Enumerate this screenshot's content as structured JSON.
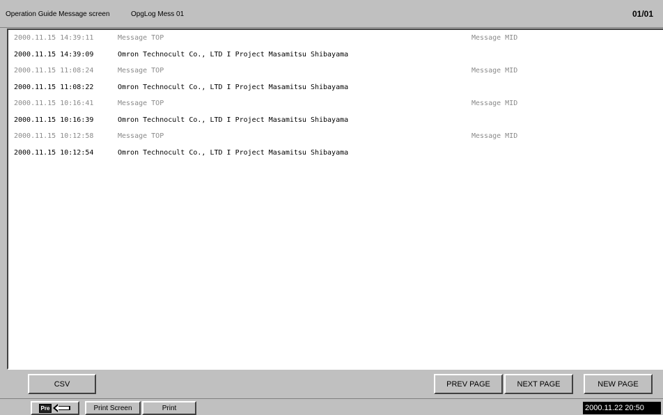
{
  "header": {
    "screen_title": "Operation Guide Message screen",
    "screen_id": "OpgLog Mess 01",
    "page_indicator": "01/01"
  },
  "log_rows": [
    {
      "timestamp": "2000.11.15 14:39:11",
      "message": "Message TOP",
      "mid": "Message MID",
      "kind": "top"
    },
    {
      "timestamp": "2000.11.15 14:39:09",
      "message": "Omron Technocult Co., LTD I Project Masamitsu Shibayama",
      "mid": "",
      "kind": "main"
    },
    {
      "timestamp": "2000.11.15 11:08:24",
      "message": "Message TOP",
      "mid": "Message MID",
      "kind": "top"
    },
    {
      "timestamp": "2000.11.15 11:08:22",
      "message": "Omron Technocult Co., LTD I Project Masamitsu Shibayama",
      "mid": "",
      "kind": "main"
    },
    {
      "timestamp": "2000.11.15 10:16:41",
      "message": "Message TOP",
      "mid": "Message MID",
      "kind": "top"
    },
    {
      "timestamp": "2000.11.15 10:16:39",
      "message": "Omron Technocult Co., LTD I Project Masamitsu Shibayama",
      "mid": "",
      "kind": "main"
    },
    {
      "timestamp": "2000.11.15 10:12:58",
      "message": "Message TOP",
      "mid": "Message MID",
      "kind": "top"
    },
    {
      "timestamp": "2000.11.15 10:12:54",
      "message": "Omron Technocult Co., LTD I Project Masamitsu Shibayama",
      "mid": "",
      "kind": "main"
    }
  ],
  "toolbar": {
    "csv_label": "CSV",
    "prev_page_label": "PREV PAGE",
    "next_page_label": "NEXT PAGE",
    "new_page_label": "NEW PAGE"
  },
  "status_bar": {
    "pre_label": "Pre",
    "pre_icon": "back-arrow-icon",
    "print_screen_label": "Print Screen",
    "print_label": "Print",
    "datetime": "2000.11.22 20:50"
  }
}
